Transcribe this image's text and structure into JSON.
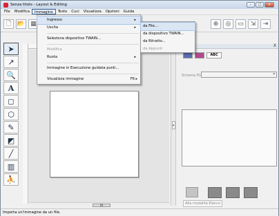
{
  "window": {
    "title": "Senza titolo - Layout & Editing",
    "btn_min": "–",
    "btn_max": "□",
    "btn_close": "✕"
  },
  "menubar": {
    "items": [
      "File",
      "Modifica",
      "Immagine",
      "Testo",
      "Cuci",
      "Visualizza",
      "Opzioni",
      "Guida"
    ]
  },
  "menu_immagine": {
    "items": [
      {
        "label": "Ingresso",
        "arrow": "▸"
      },
      {
        "label": "Uscita",
        "arrow": "▸"
      },
      {
        "label": "Seleziona dispositivo TWAIN..."
      },
      {
        "label": "Modifica"
      },
      {
        "label": "Ruota",
        "arrow": "▸"
      },
      {
        "label": "Immagine in Esecuzione guidata punti..."
      },
      {
        "label": "Visualizza immagine",
        "shortcut": "F6 ▸"
      }
    ]
  },
  "submenu_ingresso": {
    "items": [
      "da File...",
      "da dispositivo TWAIN...",
      "da Ritratto...",
      "da Appunti"
    ]
  },
  "right_panel": {
    "close": "X",
    "tab_abc": "ABC",
    "schema_label": "Schema Fil:",
    "schema_arrow": "▾",
    "apply_label": "Alla modalità Elenco"
  },
  "scroll": {
    "thumb": "III"
  },
  "status": {
    "text": "Importa un'immagine da un file."
  },
  "colors": {
    "menu_highlight": "#dbe6f4",
    "sheet": "#ffffff",
    "canvas": "#e4e4e4"
  }
}
